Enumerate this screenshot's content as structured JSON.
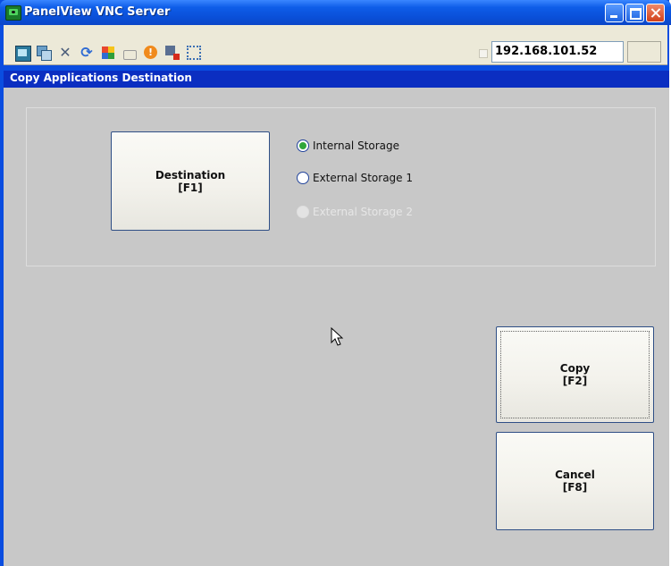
{
  "window": {
    "title": "PanelView VNC Server"
  },
  "toolbar": {
    "icons": [
      "monitor-icon",
      "windows-icon",
      "tools-icon",
      "refresh-icon",
      "windows-logo-icon",
      "keyboard-icon",
      "alert-icon",
      "network-icon",
      "fullscreen-icon"
    ],
    "ip_address": "192.168.101.52"
  },
  "screen": {
    "header": "Copy Applications Destination",
    "destination_button": {
      "line1": "Destination",
      "line2": "[F1]"
    },
    "radios": [
      {
        "label": "Internal Storage",
        "selected": true,
        "enabled": true
      },
      {
        "label": "External Storage 1",
        "selected": false,
        "enabled": true
      },
      {
        "label": "External Storage 2",
        "selected": false,
        "enabled": false
      }
    ],
    "copy_button": {
      "line1": "Copy",
      "line2": "[F2]"
    },
    "cancel_button": {
      "line1": "Cancel",
      "line2": "[F8]"
    }
  },
  "colors": {
    "titlebar": "#0a4fd8",
    "screen_header": "#0b2ec1",
    "screen_bg": "#c8c8c8",
    "selected_radio": "#2fa63a"
  }
}
